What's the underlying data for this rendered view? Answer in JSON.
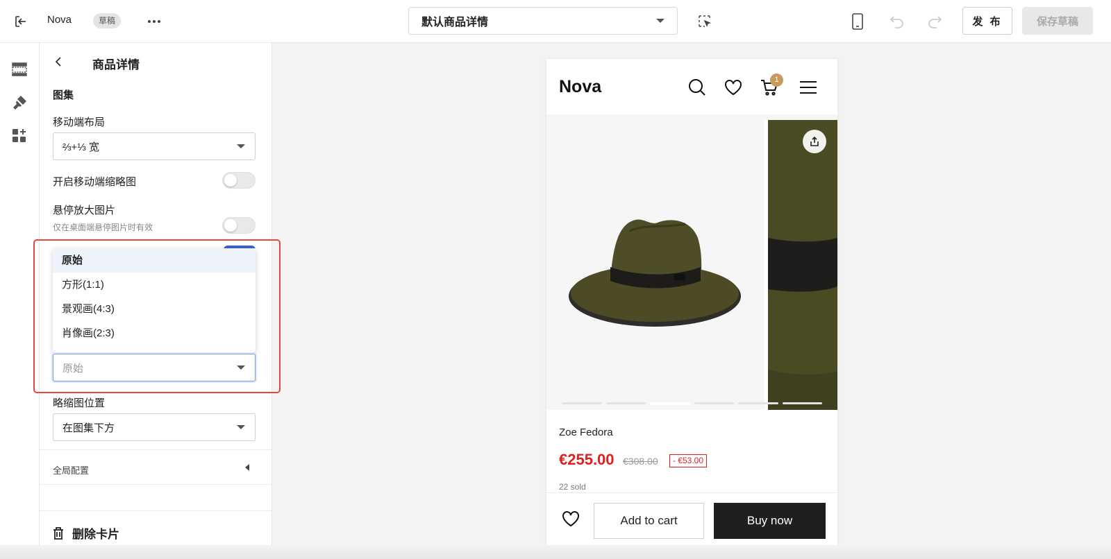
{
  "topbar": {
    "store_name": "Nova",
    "draft_badge": "草稿",
    "template_label": "默认商品详情",
    "publish_label": "发 布",
    "save_draft_label": "保存草稿"
  },
  "rail": {
    "items": [
      {
        "icon": "section-layout-icon"
      },
      {
        "icon": "theme-brush-icon"
      },
      {
        "icon": "add-apps-icon"
      }
    ]
  },
  "panel": {
    "title": "商品详情",
    "section_title": "图集",
    "mobile_layout_label": "移动端布局",
    "mobile_layout_value": "⅔+⅓ 宽",
    "mobile_thumbs_label": "开启移动端缩略图",
    "hover_zoom_label": "悬停放大图片",
    "hover_zoom_hint": "仅在桌面端悬停图片时有效",
    "ratio_options": [
      "原始",
      "方形(1:1)",
      "景观画(4:3)",
      "肖像画(2:3)"
    ],
    "ratio_value": "原始",
    "thumb_position_label": "略缩图位置",
    "thumb_position_value": "在图集下方",
    "global_config_label": "全局配置",
    "delete_label": "删除卡片"
  },
  "preview": {
    "brand": "Nova",
    "cart_count": "1",
    "product_name": "Zoe Fedora",
    "price": "€255.00",
    "original_price": "€308.00",
    "discount": "- €53.00",
    "sold": "22 sold",
    "add_to_cart": "Add to cart",
    "buy_now": "Buy now",
    "gallery_dots": 6,
    "active_dot": 3
  },
  "colors": {
    "accent_red": "#e02020",
    "highlight_outline": "#e64545",
    "badge_gold": "#c89b5c",
    "buy_button": "#1f1f1f",
    "focus_blue": "#7b9be2"
  }
}
